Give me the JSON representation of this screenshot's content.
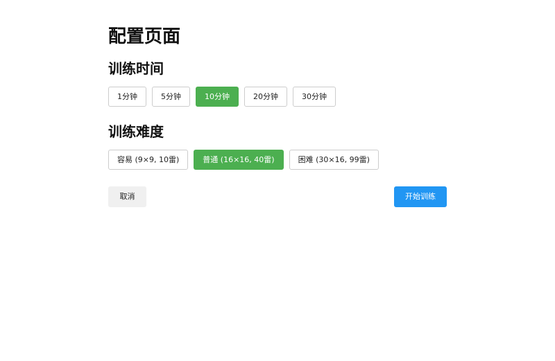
{
  "page": {
    "title": "配置页面"
  },
  "time_section": {
    "title": "训练时间",
    "options": [
      {
        "label": "1分钟",
        "selected": false
      },
      {
        "label": "5分钟",
        "selected": false
      },
      {
        "label": "10分钟",
        "selected": true
      },
      {
        "label": "20分钟",
        "selected": false
      },
      {
        "label": "30分钟",
        "selected": false
      }
    ]
  },
  "difficulty_section": {
    "title": "训练难度",
    "options": [
      {
        "label": "容易 (9×9, 10雷)",
        "selected": false
      },
      {
        "label": "普通 (16×16, 40雷)",
        "selected": true
      },
      {
        "label": "困难 (30×16, 99雷)",
        "selected": false
      }
    ]
  },
  "actions": {
    "cancel_label": "取消",
    "start_label": "开始训练"
  },
  "colors": {
    "selected": "#4caf50",
    "primary": "#2196f3",
    "secondary_bg": "#f0f0f0"
  }
}
